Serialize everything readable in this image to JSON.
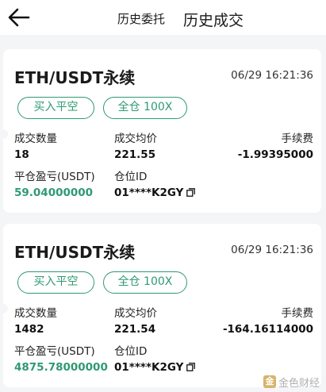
{
  "header": {
    "back_icon": "arrow-left-icon",
    "tab_orders": "历史委托",
    "tab_trades": "历史成交"
  },
  "trades": [
    {
      "title": "ETH/USDT永续",
      "time": "06/29 16:21:36",
      "side_tag": "买入平空",
      "mode_tag": "全仓 100X",
      "qty_label": "成交数量",
      "qty": "18",
      "price_label": "成交均价",
      "price": "221.55",
      "fee_label": "手续费",
      "fee": "-1.99395000",
      "pnl_label": "平仓盈亏(USDT)",
      "pnl": "59.04000000",
      "pos_label": "仓位ID",
      "pos_id": "01****K2GY"
    },
    {
      "title": "ETH/USDT永续",
      "time": "06/29 16:21:36",
      "side_tag": "买入平空",
      "mode_tag": "全仓 100X",
      "qty_label": "成交数量",
      "qty": "1482",
      "price_label": "成交均价",
      "price": "221.54",
      "fee_label": "手续费",
      "fee": "-164.16114000",
      "pnl_label": "平仓盈亏(USDT)",
      "pnl": "4875.78000000",
      "pos_label": "仓位ID",
      "pos_id": "01****K2GY"
    }
  ],
  "watermark": {
    "text": "金色财经",
    "logo_char": "金"
  },
  "colors": {
    "accent": "#2f9a72",
    "background": "#f4f5f7",
    "card": "#ffffff"
  }
}
